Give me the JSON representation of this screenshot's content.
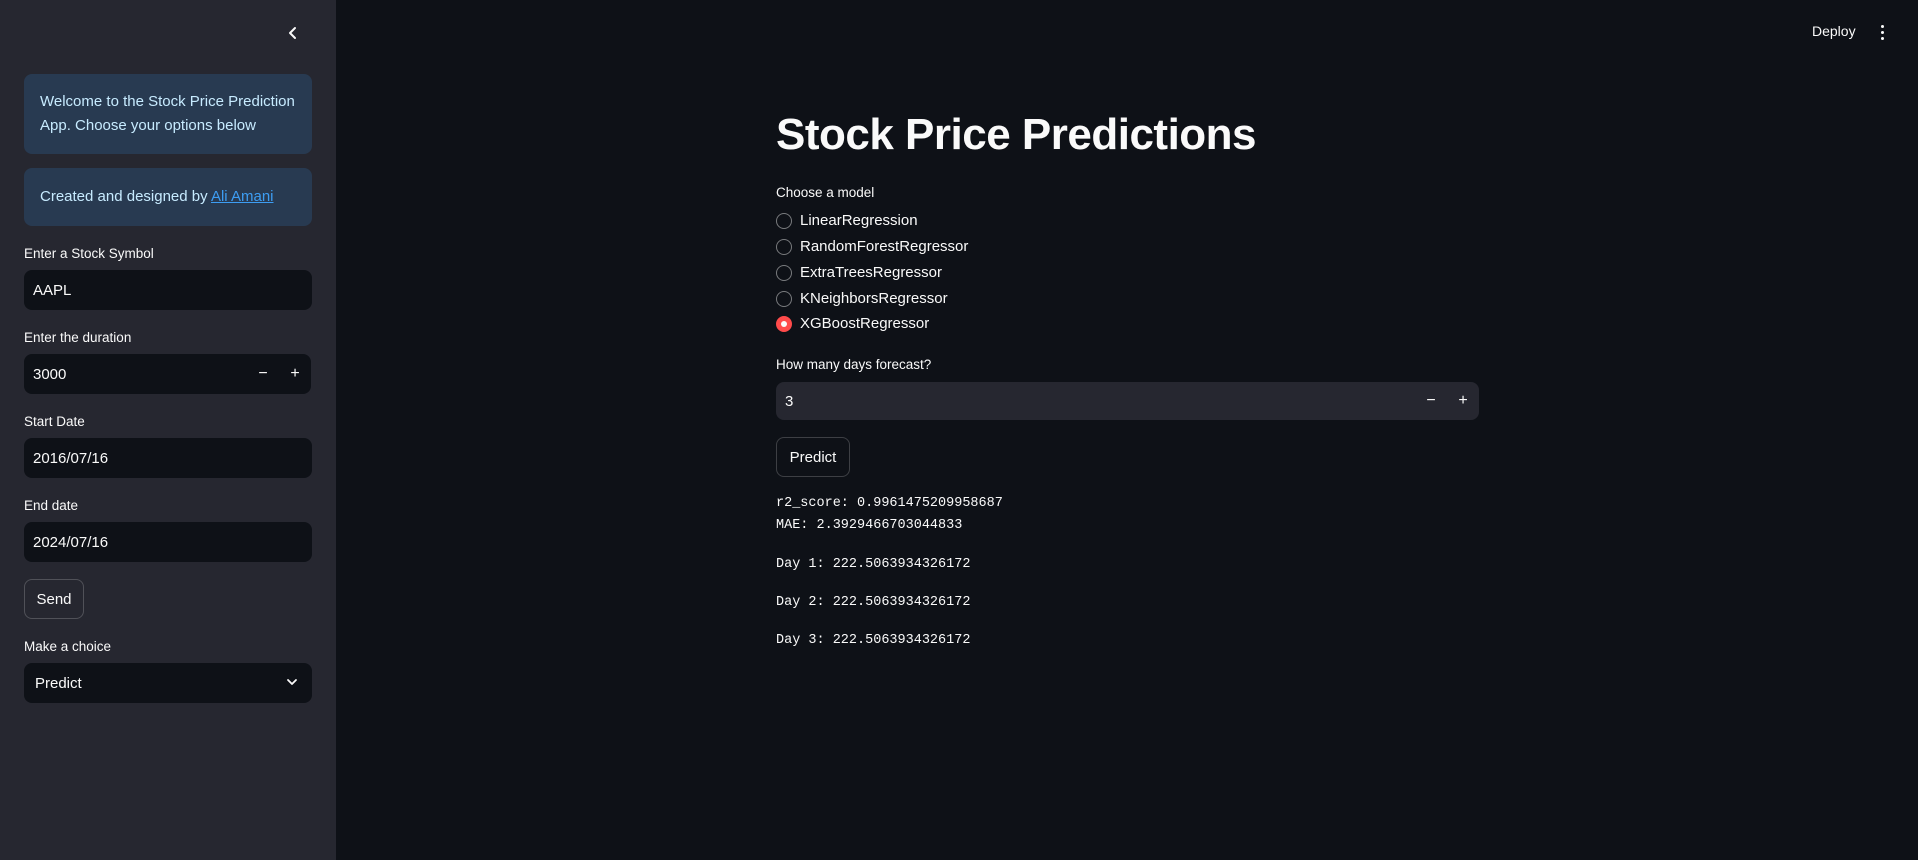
{
  "sidebar": {
    "welcome_text": "Welcome to the Stock Price Prediction App. Choose your options below",
    "credit_prefix": "Created and designed by ",
    "credit_link": "Ali Amani",
    "symbol_label": "Enter a Stock Symbol",
    "symbol_value": "AAPL",
    "duration_label": "Enter the duration",
    "duration_value": "3000",
    "start_label": "Start Date",
    "start_value": "2016/07/16",
    "end_label": "End date",
    "end_value": "2024/07/16",
    "send_label": "Send",
    "choice_label": "Make a choice",
    "choice_value": "Predict"
  },
  "header": {
    "deploy_label": "Deploy"
  },
  "main": {
    "title": "Stock Price Predictions",
    "model_label": "Choose a model",
    "models": [
      "LinearRegression",
      "RandomForestRegressor",
      "ExtraTreesRegressor",
      "KNeighborsRegressor",
      "XGBoostRegressor"
    ],
    "selected_model": "XGBoostRegressor",
    "forecast_label": "How many days forecast?",
    "forecast_value": "3",
    "predict_label": "Predict",
    "r2_line": "r2_score: 0.9961475209958687",
    "mae_line": "MAE: 2.3929466703044833",
    "days": [
      "Day 1: 222.5063934326172",
      "Day 2: 222.5063934326172",
      "Day 3: 222.5063934326172"
    ]
  },
  "colors": {
    "accent": "#ff4b4b",
    "sidebar_bg": "#262730",
    "main_bg": "#0e1117",
    "info_bg": "#283a51",
    "info_text": "#c7ebff",
    "link": "#3d9df3"
  },
  "icons": {
    "collapse": "chevron-left-icon",
    "select": "chevron-down-icon",
    "menu": "kebab-menu-icon"
  }
}
